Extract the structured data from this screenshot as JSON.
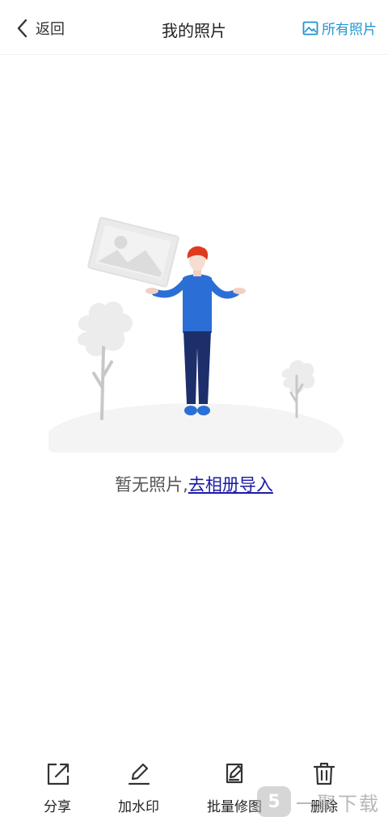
{
  "header": {
    "back_label": "返回",
    "title": "我的照片",
    "all_photos_label": "所有照片",
    "accent_color": "#1f95d1"
  },
  "empty_state": {
    "text": "暂无照片,",
    "link_text": "去相册导入"
  },
  "toolbar": {
    "items": [
      {
        "label": "分享",
        "icon": "share-icon"
      },
      {
        "label": "加水印",
        "icon": "edit-icon"
      },
      {
        "label": "批量修图",
        "icon": "batch-edit-icon"
      },
      {
        "label": "删除",
        "icon": "trash-icon"
      }
    ]
  },
  "watermark": {
    "badge": "5",
    "text": "一聚下载"
  }
}
